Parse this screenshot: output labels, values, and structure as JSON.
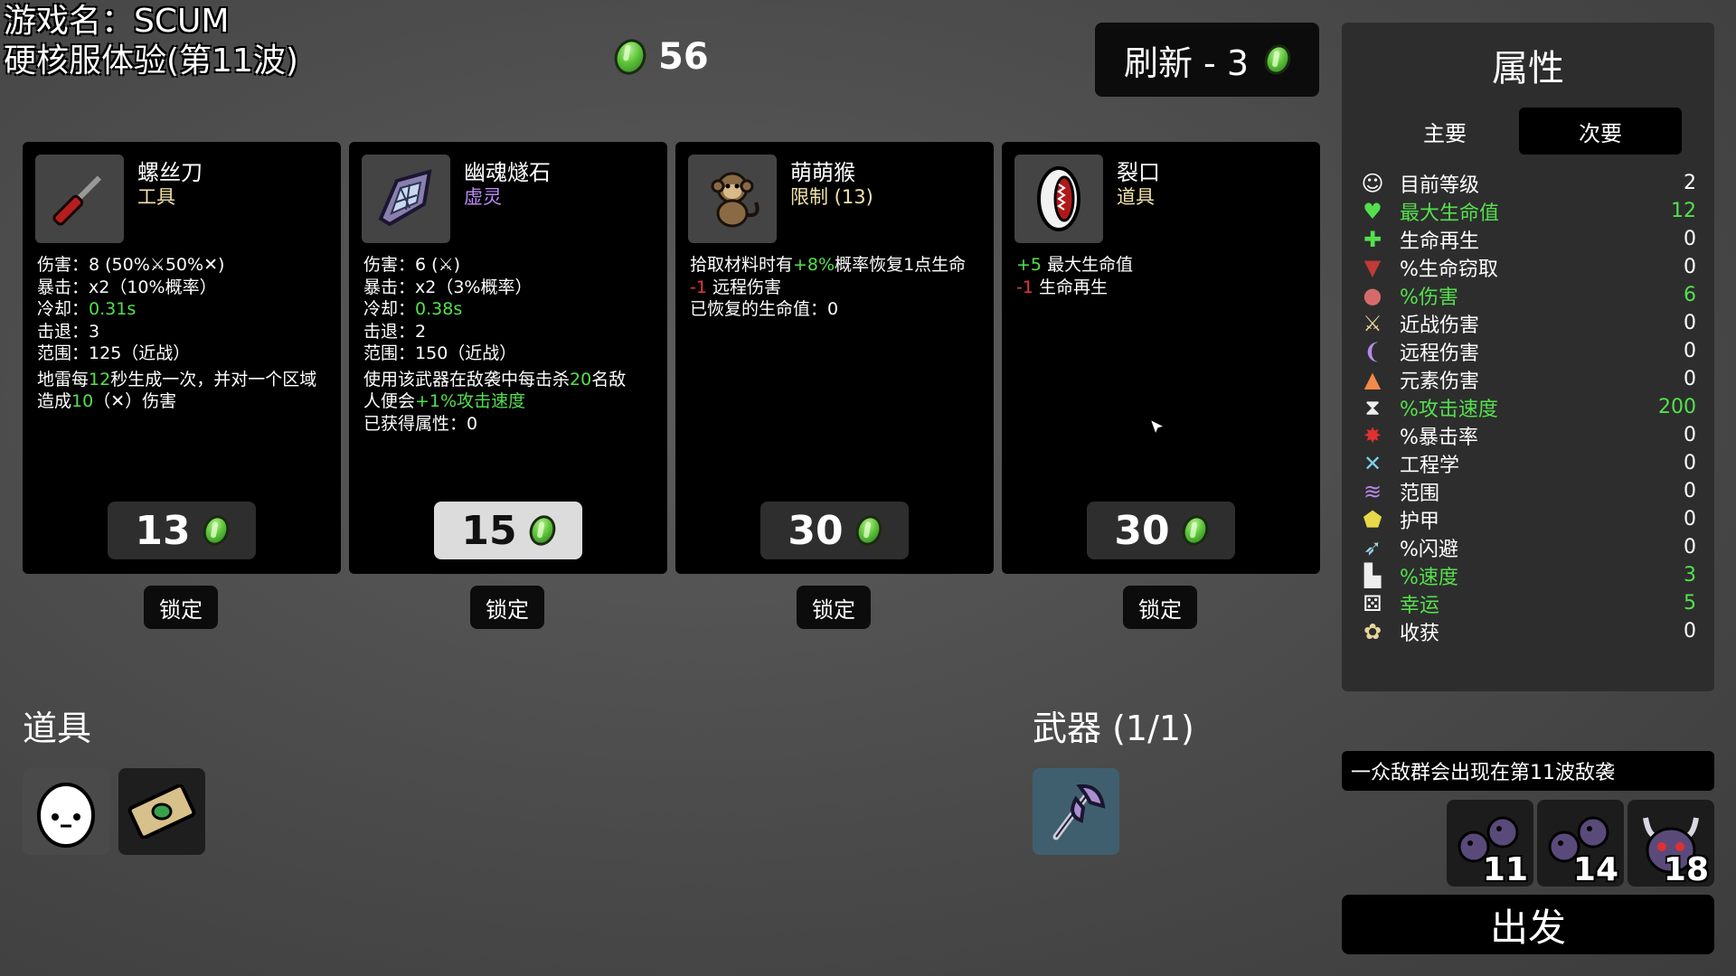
{
  "overlay": {
    "line1": "游戏名：SCUM",
    "line2": "硬核服体验",
    "line3": "(第11波)"
  },
  "materials": {
    "count": "56"
  },
  "reroll": {
    "label": "刷新 - 3"
  },
  "shop": [
    {
      "name": "螺丝刀",
      "type": "工具",
      "icon": "screwdriver-icon",
      "stats": {
        "damage_label": "伤害：",
        "damage_value": "8 (50%",
        "damage_mid": "50%",
        "damage_end": ")",
        "crit_label": "暴击：",
        "crit_value": "x2（10%概率）",
        "cooldown_label": "冷却：",
        "cooldown_value": "0.31s",
        "knockback_label": "击退：",
        "knockback_value": "3",
        "range_label": "范围：",
        "range_value": "125（近战）",
        "effect_a": "地雷每",
        "effect_num": "12",
        "effect_b": "秒生成一次，并对一个区域",
        "effect_c": "造成",
        "effect_dmg": "10",
        "effect_d": "（",
        "effect_e": "）伤害"
      },
      "price": "13",
      "highlight": false,
      "lock_label": "锁定"
    },
    {
      "name": "幽魂燧石",
      "type": "虚灵",
      "icon": "ghost-flint-icon",
      "stats": {
        "damage_label": "伤害：",
        "damage_value": "6 (",
        "damage_end": ")",
        "crit_label": "暴击：",
        "crit_value": "x2（3%概率）",
        "cooldown_label": "冷却：",
        "cooldown_value": "0.38s",
        "knockback_label": "击退：",
        "knockback_value": "2",
        "range_label": "范围：",
        "range_value": "150（近战）",
        "effect_a": "使用该武器在敌袭中每击杀",
        "effect_num": "20",
        "effect_b": "名敌",
        "effect_c": "人便会",
        "effect_bonus": "+1%攻击速度",
        "gained": "已获得属性：0"
      },
      "price": "15",
      "highlight": true,
      "lock_label": "锁定"
    },
    {
      "name": "萌萌猴",
      "type": "限制 (13)",
      "icon": "monkey-icon",
      "lines": {
        "a": "拾取材料时有",
        "a_green": "+8%",
        "a_end": "概率恢复1点生命",
        "b_red": "-1",
        "b": "远程伤害",
        "c": "已恢复的生命值：0"
      },
      "price": "30",
      "highlight": false,
      "lock_label": "锁定"
    },
    {
      "name": "裂口",
      "type": "道具",
      "icon": "mouth-icon",
      "lines": {
        "a_green": "+5",
        "a": "最大生命值",
        "b_red": "-1",
        "b": "生命再生"
      },
      "price": "30",
      "highlight": false,
      "lock_label": "锁定"
    }
  ],
  "items_section": {
    "title": "道具",
    "items": [
      {
        "icon": "egg-face-icon"
      },
      {
        "icon": "cash-bill-icon"
      }
    ]
  },
  "weapons_section": {
    "title": "武器 (1/1)",
    "items": [
      {
        "icon": "axe-icon"
      }
    ]
  },
  "stats": {
    "title": "属性",
    "tab_primary": "主要",
    "tab_secondary": "次要",
    "rows": [
      {
        "icon": "level-icon",
        "label": "目前等级",
        "value": "2",
        "hi": false
      },
      {
        "icon": "heart-icon",
        "label": "最大生命值",
        "value": "12",
        "hi": true
      },
      {
        "icon": "heart-plus-icon",
        "label": "生命再生",
        "value": "0",
        "hi": false
      },
      {
        "icon": "fang-icon",
        "label": "%生命窃取",
        "value": "0",
        "hi": false
      },
      {
        "icon": "muscle-icon",
        "label": "%伤害",
        "value": "6",
        "hi": true
      },
      {
        "icon": "sword-icon",
        "label": "近战伤害",
        "value": "0",
        "hi": false
      },
      {
        "icon": "bow-icon",
        "label": "远程伤害",
        "value": "0",
        "hi": false
      },
      {
        "icon": "flame-icon",
        "label": "元素伤害",
        "value": "0",
        "hi": false
      },
      {
        "icon": "hourglass-icon",
        "label": "%攻击速度",
        "value": "200",
        "hi": true
      },
      {
        "icon": "crit-burst-icon",
        "label": "%暴击率",
        "value": "0",
        "hi": false
      },
      {
        "icon": "wrench-icon",
        "label": "工程学",
        "value": "0",
        "hi": false
      },
      {
        "icon": "range-wave-icon",
        "label": "范围",
        "value": "0",
        "hi": false
      },
      {
        "icon": "shield-icon",
        "label": "护甲",
        "value": "0",
        "hi": false
      },
      {
        "icon": "dodge-icon",
        "label": "%闪避",
        "value": "0",
        "hi": false
      },
      {
        "icon": "boot-icon",
        "label": "%速度",
        "value": "3",
        "hi": true
      },
      {
        "icon": "dice-icon",
        "label": "幸运",
        "value": "5",
        "hi": true
      },
      {
        "icon": "wheat-icon",
        "label": "收获",
        "value": "0",
        "hi": false
      }
    ]
  },
  "waves": {
    "notice": "一众敌群会出现在第11波敌袭",
    "enemies": [
      {
        "icon": "bug-swarm-icon",
        "wave": "11"
      },
      {
        "icon": "bug-swarm-icon",
        "wave": "14"
      },
      {
        "icon": "horned-boss-icon",
        "wave": "18"
      }
    ]
  },
  "go_button": {
    "label": "出发"
  },
  "colors": {
    "green": "#54e04d",
    "red": "#e63838",
    "panel": "#2d2d2d",
    "card": "#000000",
    "tier_item": "#f2e3a8",
    "tier_ethereal": "#b98bf3"
  }
}
